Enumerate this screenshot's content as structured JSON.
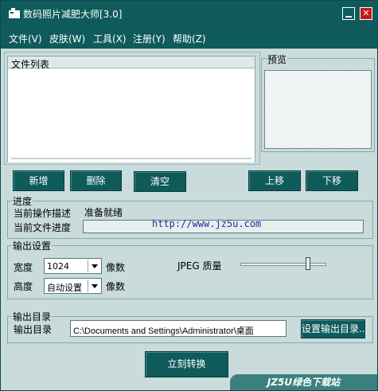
{
  "window": {
    "title": "数码照片减肥大师[3.0]"
  },
  "menu": [
    "文件(V)",
    "皮肤(W)",
    "工具(X)",
    "注册(Y)",
    "帮助(Z)"
  ],
  "file_list": {
    "header": "文件列表"
  },
  "preview": {
    "title": "预览"
  },
  "list_buttons": {
    "add": "新增",
    "delete": "删除",
    "clear": "清空",
    "move_up": "上移",
    "move_down": "下移"
  },
  "progress": {
    "title": "进度",
    "operation_label": "当前操作描述",
    "operation_value": "准备就绪",
    "file_progress_label": "当前文件进度",
    "file_progress_value": 0,
    "overlay_text": "http://www.jz5u.com"
  },
  "output_settings": {
    "title": "输出设置",
    "width_label": "宽度",
    "width_value": "1024",
    "height_label": "高度",
    "height_value": "自动设置",
    "unit": "像数",
    "jpeg_quality_label": "JPEG 质量",
    "jpeg_quality_level": 0.8
  },
  "output_dir": {
    "title": "输出目录",
    "label": "输出目录",
    "path": "C:\\Documents and Settings\\Administrator\\桌面",
    "set_button": "设置输出目录..."
  },
  "convert_button": "立刻转换",
  "watermark": "JZ5U绿色下载站 www.jz5u.com"
}
